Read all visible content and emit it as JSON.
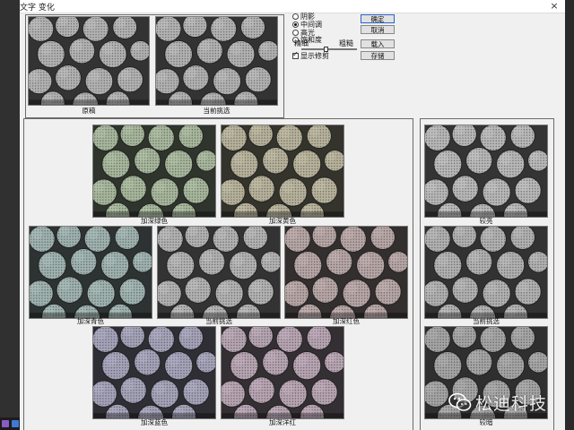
{
  "dialog": {
    "title": "文字 变化",
    "close_glyph": "×"
  },
  "top_previews": [
    {
      "label": "原稿"
    },
    {
      "label": "当前挑选"
    }
  ],
  "tone_options": [
    {
      "label": "阴影",
      "selected": false
    },
    {
      "label": "中间调",
      "selected": true
    },
    {
      "label": "高光",
      "selected": false
    },
    {
      "label": "饱和度",
      "selected": false
    }
  ],
  "slider": {
    "left_label": "精细",
    "right_label": "粗糙"
  },
  "show_clipping": {
    "label": "显示修剪",
    "checked": true
  },
  "buttons": {
    "ok": "确定",
    "cancel": "取消",
    "load": "载入",
    "save": "存储"
  },
  "variations": {
    "top_left": {
      "label": "加深绿色",
      "tint": "#8fb07a"
    },
    "top_mid": {
      "label": "加深黄色",
      "tint": "#b0a877"
    },
    "mid_left": {
      "label": "加深青色",
      "tint": "#7fa8a2"
    },
    "mid_center": {
      "label": "当前挑选",
      "tint": "#a8a8a8"
    },
    "mid_right": {
      "label": "加深红色",
      "tint": "#b08e8e"
    },
    "bottom_left": {
      "label": "加深蓝色",
      "tint": "#8c87b4"
    },
    "bottom_mid": {
      "label": "加深洋红",
      "tint": "#b08aa8"
    }
  },
  "brightness": {
    "lighter": {
      "label": "较亮",
      "tint": "#b3b3b3"
    },
    "current": {
      "label": "当前挑选",
      "tint": "#a3a3a3"
    },
    "darker": {
      "label": "较暗",
      "tint": "#8a8a8a"
    }
  },
  "watermark": {
    "text": "松迪科技",
    "icon": "wechat-icon"
  }
}
